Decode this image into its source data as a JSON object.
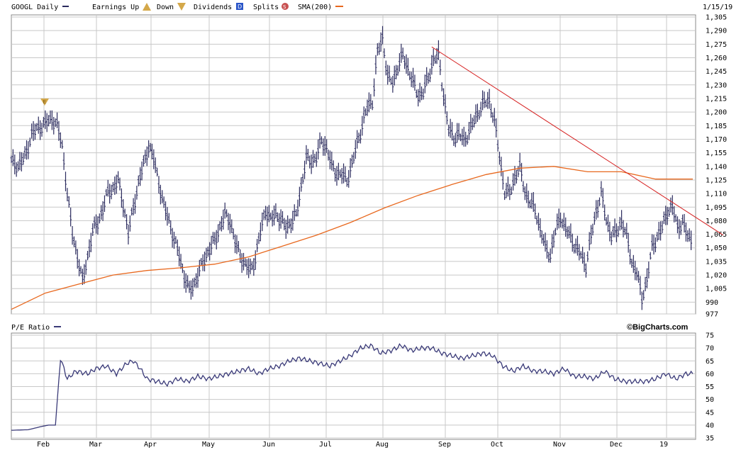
{
  "header": {
    "symbol_label": "GOOGL Daily",
    "earnings_up": "Earnings Up",
    "earnings_down": "Down",
    "dividends": "Dividends",
    "dividends_badge": "D",
    "splits": "Splits",
    "splits_badge": "S",
    "sma": "SMA(200)",
    "date": "1/15/19",
    "earnings_glyph": "E"
  },
  "lower": {
    "title": "P/E Ratio",
    "brand": "©BigCharts.com"
  },
  "colors": {
    "price_bars": "#2b2b5e",
    "sma": "#e8681e",
    "trendline": "#d62020",
    "grid": "#c8c8c8",
    "pe_line": "#3a3a78",
    "earnings_marker": "#d4a84a"
  },
  "chart_data": [
    {
      "type": "line",
      "title": "GOOGL Daily",
      "ylim": [
        977,
        1305
      ],
      "yticks": [
        1305,
        1290,
        1275,
        1260,
        1245,
        1230,
        1215,
        1200,
        1185,
        1170,
        1155,
        1140,
        1125,
        1110,
        1095,
        1080,
        1065,
        1050,
        1035,
        1020,
        1005,
        990,
        977
      ],
      "x_labels": [
        "Feb",
        "Mar",
        "Apr",
        "May",
        "Jun",
        "Jul",
        "Aug",
        "Sep",
        "Oct",
        "Nov",
        "Dec",
        "19"
      ],
      "series": [
        {
          "name": "Price",
          "points": [
            [
              0,
              1145
            ],
            [
              4,
              1140
            ],
            [
              8,
              1150
            ],
            [
              12,
              1175
            ],
            [
              16,
              1182
            ],
            [
              20,
              1187
            ],
            [
              24,
              1192
            ],
            [
              27,
              1185
            ],
            [
              30,
              1162
            ],
            [
              33,
              1110
            ],
            [
              36,
              1065
            ],
            [
              39,
              1040
            ],
            [
              42,
              1012
            ],
            [
              45,
              1040
            ],
            [
              48,
              1068
            ],
            [
              51,
              1078
            ],
            [
              54,
              1092
            ],
            [
              57,
              1112
            ],
            [
              60,
              1115
            ],
            [
              63,
              1124
            ],
            [
              66,
              1098
            ],
            [
              69,
              1065
            ],
            [
              72,
              1095
            ],
            [
              75,
              1120
            ],
            [
              78,
              1142
            ],
            [
              81,
              1162
            ],
            [
              84,
              1148
            ],
            [
              87,
              1122
            ],
            [
              90,
              1095
            ],
            [
              93,
              1080
            ],
            [
              96,
              1058
            ],
            [
              99,
              1042
            ],
            [
              102,
              1018
            ],
            [
              105,
              1002
            ],
            [
              108,
              1010
            ],
            [
              111,
              1024
            ],
            [
              114,
              1038
            ],
            [
              117,
              1048
            ],
            [
              120,
              1058
            ],
            [
              123,
              1072
            ],
            [
              126,
              1086
            ],
            [
              129,
              1080
            ],
            [
              132,
              1055
            ],
            [
              135,
              1042
            ],
            [
              138,
              1030
            ],
            [
              141,
              1025
            ],
            [
              144,
              1038
            ],
            [
              147,
              1068
            ],
            [
              150,
              1092
            ],
            [
              153,
              1080
            ],
            [
              156,
              1088
            ],
            [
              159,
              1080
            ],
            [
              162,
              1072
            ],
            [
              165,
              1078
            ],
            [
              168,
              1085
            ],
            [
              171,
              1118
            ],
            [
              174,
              1148
            ],
            [
              177,
              1145
            ],
            [
              180,
              1150
            ],
            [
              183,
              1168
            ],
            [
              186,
              1160
            ],
            [
              189,
              1140
            ],
            [
              192,
              1132
            ],
            [
              195,
              1130
            ],
            [
              198,
              1125
            ],
            [
              201,
              1142
            ],
            [
              204,
              1165
            ],
            [
              207,
              1185
            ],
            [
              210,
              1205
            ],
            [
              213,
              1212
            ],
            [
              216,
              1265
            ],
            [
              219,
              1282
            ],
            [
              222,
              1238
            ],
            [
              225,
              1232
            ],
            [
              228,
              1250
            ],
            [
              231,
              1262
            ],
            [
              234,
              1248
            ],
            [
              237,
              1232
            ],
            [
              240,
              1218
            ],
            [
              243,
              1222
            ],
            [
              246,
              1238
            ],
            [
              249,
              1258
            ],
            [
              252,
              1262
            ],
            [
              255,
              1218
            ],
            [
              258,
              1180
            ],
            [
              261,
              1172
            ],
            [
              264,
              1175
            ],
            [
              267,
              1168
            ],
            [
              270,
              1178
            ],
            [
              273,
              1190
            ],
            [
              276,
              1202
            ],
            [
              279,
              1210
            ],
            [
              282,
              1212
            ],
            [
              285,
              1190
            ],
            [
              288,
              1150
            ],
            [
              291,
              1112
            ],
            [
              294,
              1110
            ],
            [
              297,
              1128
            ],
            [
              300,
              1138
            ],
            [
              303,
              1112
            ],
            [
              306,
              1100
            ],
            [
              309,
              1092
            ],
            [
              312,
              1070
            ],
            [
              315,
              1050
            ],
            [
              318,
              1042
            ],
            [
              321,
              1068
            ],
            [
              324,
              1085
            ],
            [
              327,
              1070
            ],
            [
              330,
              1062
            ],
            [
              333,
              1050
            ],
            [
              336,
              1042
            ],
            [
              339,
              1030
            ],
            [
              342,
              1062
            ],
            [
              345,
              1090
            ],
            [
              348,
              1110
            ],
            [
              351,
              1080
            ],
            [
              354,
              1064
            ],
            [
              357,
              1066
            ],
            [
              360,
              1080
            ],
            [
              363,
              1062
            ],
            [
              366,
              1034
            ],
            [
              369,
              1022
            ],
            [
              372,
              994
            ],
            [
              375,
              1015
            ],
            [
              378,
              1050
            ],
            [
              381,
              1062
            ],
            [
              384,
              1072
            ],
            [
              387,
              1090
            ],
            [
              390,
              1095
            ],
            [
              393,
              1072
            ],
            [
              396,
              1078
            ],
            [
              399,
              1062
            ],
            [
              402,
              1058
            ]
          ]
        },
        {
          "name": "SMA(200)",
          "points": [
            [
              0,
              982
            ],
            [
              20,
              1000
            ],
            [
              40,
              1010
            ],
            [
              60,
              1020
            ],
            [
              80,
              1025
            ],
            [
              100,
              1028
            ],
            [
              120,
              1032
            ],
            [
              140,
              1040
            ],
            [
              160,
              1052
            ],
            [
              180,
              1064
            ],
            [
              200,
              1078
            ],
            [
              220,
              1094
            ],
            [
              240,
              1108
            ],
            [
              260,
              1120
            ],
            [
              280,
              1131
            ],
            [
              300,
              1138
            ],
            [
              320,
              1140
            ],
            [
              340,
              1134
            ],
            [
              360,
              1134
            ],
            [
              380,
              1126
            ],
            [
              402,
              1126
            ]
          ]
        },
        {
          "name": "Trendline",
          "points": [
            [
              248,
              1272
            ],
            [
              420,
              1064
            ]
          ]
        }
      ]
    },
    {
      "type": "line",
      "title": "P/E Ratio",
      "ylim": [
        35,
        75
      ],
      "yticks": [
        75,
        70,
        65,
        60,
        55,
        50,
        45,
        40,
        35
      ],
      "series": [
        {
          "name": "P/E Ratio",
          "points": [
            [
              0,
              38
            ],
            [
              10,
              38.2
            ],
            [
              18,
              39.5
            ],
            [
              22,
              40
            ],
            [
              26,
              40
            ],
            [
              29,
              66
            ],
            [
              33,
              58
            ],
            [
              38,
              61
            ],
            [
              45,
              60
            ],
            [
              50,
              62
            ],
            [
              56,
              63
            ],
            [
              62,
              60
            ],
            [
              68,
              64
            ],
            [
              72,
              65
            ],
            [
              76,
              62
            ],
            [
              80,
              58
            ],
            [
              86,
              57
            ],
            [
              92,
              56
            ],
            [
              98,
              58
            ],
            [
              104,
              57
            ],
            [
              110,
              59
            ],
            [
              116,
              58
            ],
            [
              122,
              59
            ],
            [
              128,
              60
            ],
            [
              134,
              61
            ],
            [
              140,
              62
            ],
            [
              146,
              60
            ],
            [
              152,
              62
            ],
            [
              158,
              63
            ],
            [
              164,
              65
            ],
            [
              170,
              66
            ],
            [
              176,
              65
            ],
            [
              182,
              64
            ],
            [
              188,
              63
            ],
            [
              194,
              65
            ],
            [
              200,
              67
            ],
            [
              206,
              70
            ],
            [
              212,
              71
            ],
            [
              218,
              68
            ],
            [
              224,
              69
            ],
            [
              230,
              71
            ],
            [
              236,
              69
            ],
            [
              242,
              70
            ],
            [
              248,
              70
            ],
            [
              254,
              68
            ],
            [
              260,
              67
            ],
            [
              266,
              66
            ],
            [
              272,
              67
            ],
            [
              278,
              68
            ],
            [
              284,
              67
            ],
            [
              290,
              63
            ],
            [
              296,
              61
            ],
            [
              302,
              63
            ],
            [
              308,
              61
            ],
            [
              314,
              61
            ],
            [
              320,
              60
            ],
            [
              326,
              62
            ],
            [
              332,
              59
            ],
            [
              338,
              59
            ],
            [
              344,
              58
            ],
            [
              350,
              61
            ],
            [
              356,
              58
            ],
            [
              362,
              57
            ],
            [
              368,
              57
            ],
            [
              374,
              57
            ],
            [
              380,
              58
            ],
            [
              386,
              60
            ],
            [
              392,
              58
            ],
            [
              398,
              60
            ],
            [
              402,
              60
            ]
          ]
        }
      ]
    }
  ]
}
